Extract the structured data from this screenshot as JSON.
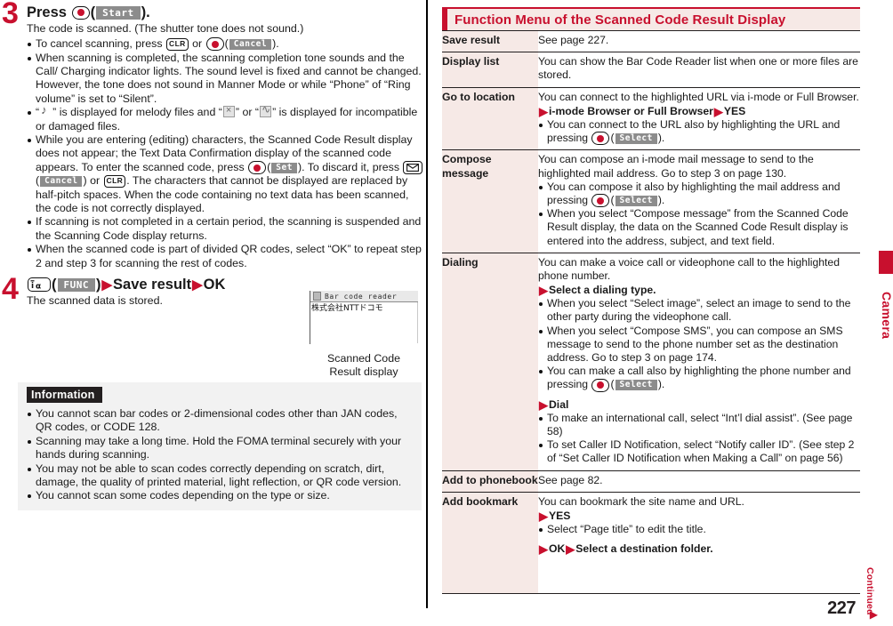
{
  "left": {
    "step3": {
      "number": "3",
      "head_pre": "Press",
      "head_key": "center-key",
      "head_softkey": "Start",
      "head_post": ").",
      "sub": "The code is scanned. (The shutter tone does not sound.)",
      "bullets": [
        {
          "id": "cancel-scanning",
          "parts": [
            "To cancel scanning, press",
            "CLR",
            "or",
            "center-key",
            "Cancel",
            ")."
          ]
        },
        {
          "id": "scan-complete",
          "text": "When scanning is completed, the scanning completion tone sounds and the Call/ Charging indicator lights. The sound level is fixed and cannot be changed. However, the tone does not sound in Manner Mode or while “Phone” of “Ring volume” is set to “Silent”."
        },
        {
          "id": "melody-icons",
          "text": "“ ” is displayed for melody files and “ ” or “ ” is displayed for incompatible or damaged files."
        },
        {
          "id": "editing-characters",
          "text": "While you are entering (editing) characters, the Scanned Code Result display does not appear; the Text Data Confirmation display of the scanned code appears. To enter the scanned code, press"
        },
        {
          "id": "scan-timeout",
          "text": "If scanning is not completed in a certain period, the scanning is suspended and the Scanning Code display returns."
        },
        {
          "id": "divided-qr",
          "text": "When the scanned code is part of divided QR codes, select “OK” to repeat step 2 and step 3 for scanning the rest of codes."
        }
      ],
      "editing_softkey_set": "Set",
      "editing_mid": "). To discard it, press",
      "editing_softkey_cancel": "Cancel",
      "editing_or": "or",
      "editing_clr": "CLR",
      "editing_tail": ". The characters that cannot be displayed are replaced by half-pitch spaces. When the code containing no text data has been scanned, the code is not correctly displayed."
    },
    "step4": {
      "number": "4",
      "key_ifunc": "iα",
      "softkey": "FUNC",
      "close_paren": ")",
      "item1": "Save result",
      "item2": "OK",
      "sub": "The scanned data is stored."
    },
    "figure": {
      "title": "Bar code reader",
      "body": "株式会社NTTドコモ",
      "caption_line1": "Scanned Code",
      "caption_line2": "Result display"
    },
    "information": {
      "title": "Information",
      "items": [
        "You cannot scan bar codes or 2-dimensional codes other than JAN codes, QR codes, or CODE 128.",
        "Scanning may take a long time. Hold the FOMA terminal securely with your hands during scanning.",
        "You may not be able to scan codes correctly depending on scratch, dirt, damage, the quality of printed material, light reflection, or QR code version.",
        "You cannot scan some codes depending on the type or size."
      ]
    }
  },
  "right": {
    "section_title": "Function Menu of the Scanned Code Result Display",
    "rows": [
      {
        "key": "Save result",
        "lead": "See page 227.",
        "bullets": [],
        "substeps": []
      },
      {
        "key": "Display list",
        "lead": "You can show the Bar Code Reader list when one or more files are stored.",
        "bullets": [],
        "substeps": []
      },
      {
        "key": "Go to location",
        "lead": "You can connect to the highlighted URL via i-mode or Full Browser.",
        "substep1": "i-mode Browser or Full Browser",
        "substep2": "YES",
        "bullet_url": "You can connect to the URL also by highlighting the URL and pressing",
        "softkey": "Select"
      },
      {
        "key": "Compose message",
        "lead": "You can compose an i-mode mail message to send to the highlighted mail address. Go to step 3 on page 130.",
        "bullet_compose": "You can compose it also by highlighting the mail address and pressing",
        "softkey": "Select",
        "bullet_last": "When you select “Compose message” from the Scanned Code Result display, the data on the Scanned Code Result display is entered into the address, subject, and text field."
      },
      {
        "key": "Dialing",
        "lead": "You can make a voice call or videophone call to the highlighted phone number.",
        "substep1": "Select a dialing type.",
        "bullet1": "When you select “Select image”, select an image to send to the other party during the videophone call.",
        "bullet2": "When you select “Compose SMS”, you can compose an SMS message to send to the phone number set as the destination address. Go to step 3 on page 174.",
        "bullet3": "You can make a call also by highlighting the phone number and pressing",
        "softkey": "Select",
        "substep2": "Dial",
        "bullet4": "To make an international call, select “Int’l dial assist”. (See page 58)",
        "bullet5": "To set Caller ID Notification, select “Notify caller ID”. (See step 2 of “Set Caller ID Notification when Making a Call” on page 56)"
      },
      {
        "key": "Add to phonebook",
        "lead": "See page 82.",
        "bullets": [],
        "substeps": []
      },
      {
        "key": "Add bookmark",
        "lead": "You can bookmark the site name and URL.",
        "substep1": "YES",
        "bullet1": "Select “Page title” to edit the title.",
        "substep2_a": "OK",
        "substep2_b": "Select a destination folder."
      }
    ]
  },
  "sidebar": {
    "tab_label": "Camera"
  },
  "footer": {
    "page_number": "227",
    "continued": "Continued"
  },
  "colors": {
    "accent_red": "#c8102e",
    "key_tint": "#f6e9e6",
    "info_bg": "#f2f2f2",
    "softkey_gray": "#8c8c8c"
  }
}
